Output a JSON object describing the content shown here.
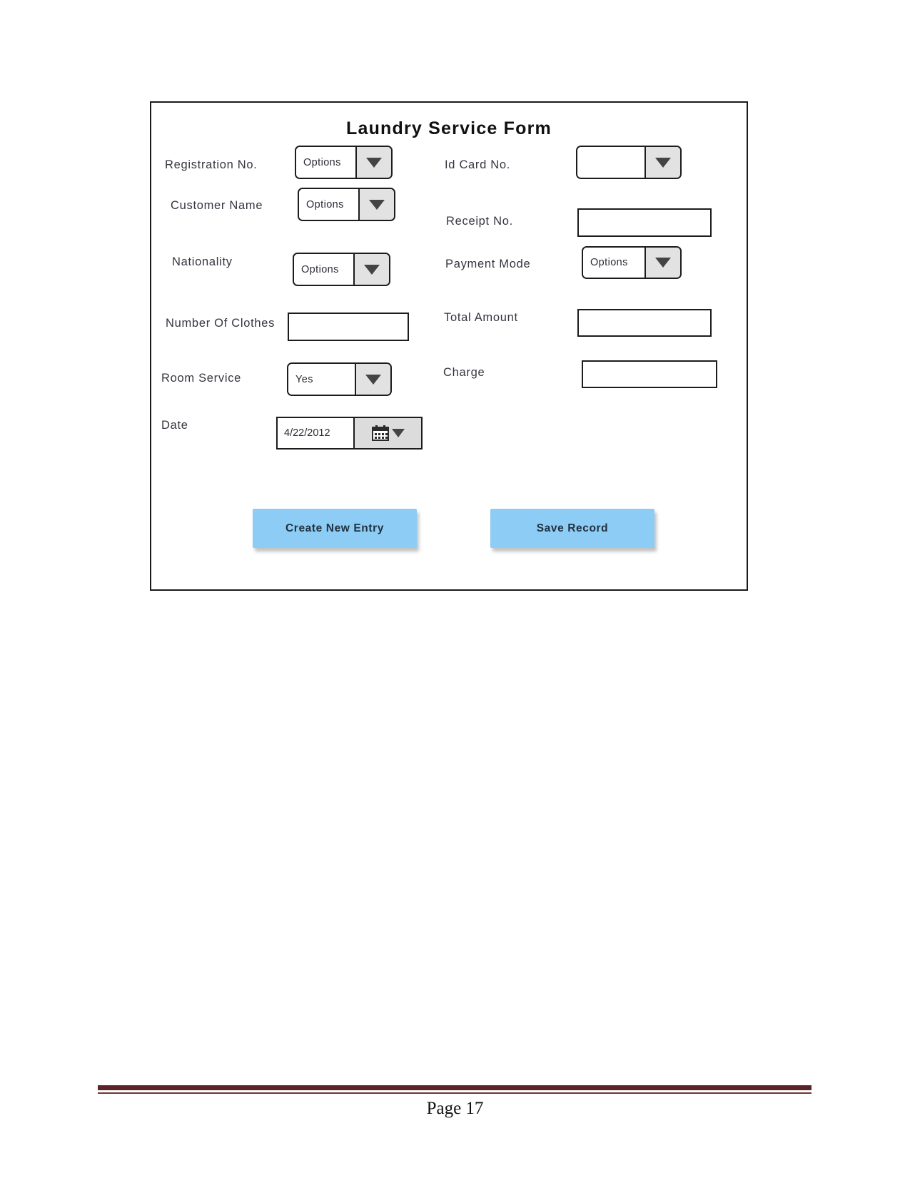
{
  "document": {
    "footer": {
      "page_label": "Page 17",
      "rule_color": "#5B2327"
    }
  },
  "form": {
    "title": "Laundry Service Form",
    "accent_button_color": "#8CCCF5",
    "left_column": [
      {
        "label": "Registration No.",
        "control": "dropdown",
        "value": "Options"
      },
      {
        "label": "Customer Name",
        "control": "dropdown",
        "value": "Options"
      },
      {
        "label": "Nationality",
        "control": "dropdown",
        "value": "Options"
      },
      {
        "label": "Number Of Clothes",
        "control": "textbox",
        "value": ""
      },
      {
        "label": "Room Service",
        "control": "dropdown",
        "value": "Yes"
      },
      {
        "label": "Date",
        "control": "datepicker",
        "value": "4/22/2012"
      }
    ],
    "right_column": [
      {
        "label": "Id Card No.",
        "control": "dropdown",
        "value": ""
      },
      {
        "label": "Receipt No.",
        "control": "textbox",
        "value": ""
      },
      {
        "label": "Payment Mode",
        "control": "dropdown",
        "value": "Options"
      },
      {
        "label": "Total Amount",
        "control": "textbox",
        "value": ""
      },
      {
        "label": "Charge",
        "control": "textbox",
        "value": ""
      }
    ],
    "buttons": [
      {
        "label": "Create New Entry"
      },
      {
        "label": "Save Record"
      }
    ]
  }
}
